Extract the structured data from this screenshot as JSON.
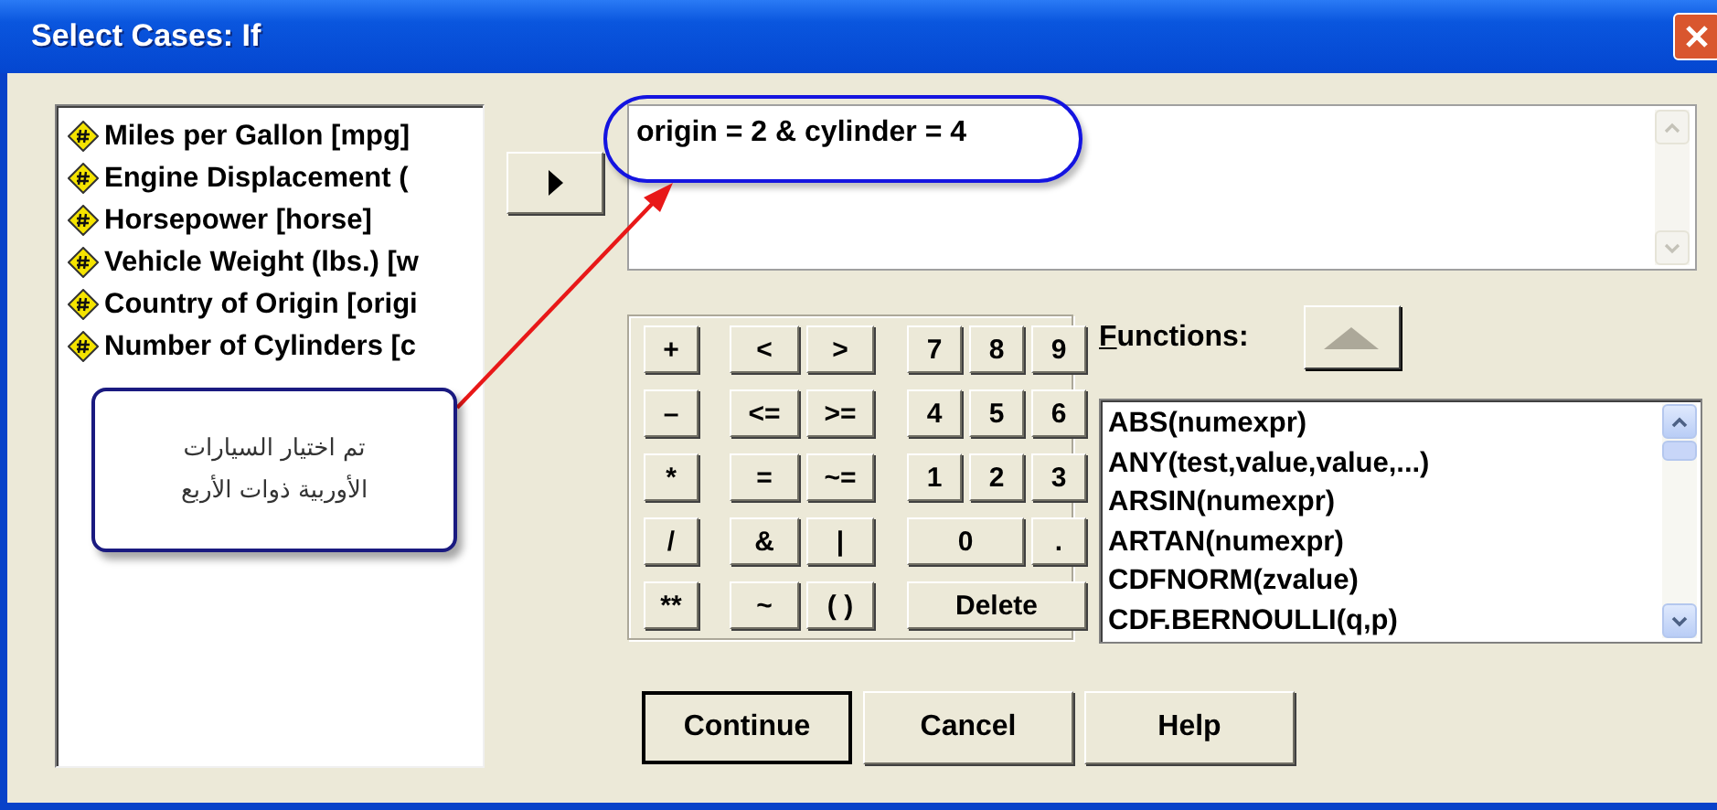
{
  "window": {
    "title": "Select Cases: If"
  },
  "variables": [
    {
      "label": "Miles per Gallon [mpg]"
    },
    {
      "label": "Engine Displacement ("
    },
    {
      "label": "Horsepower [horse]"
    },
    {
      "label": "Vehicle Weight (lbs.) [w"
    },
    {
      "label": "Country of Origin [origi"
    },
    {
      "label": "Number of Cylinders [c"
    }
  ],
  "expression": {
    "value": "origin = 2 & cylinder = 4"
  },
  "keypad": [
    [
      {
        "label": "+",
        "kind": "key"
      },
      {
        "label": "<",
        "kind": "key"
      },
      {
        "label": ">",
        "kind": "key"
      },
      {
        "label": "7",
        "kind": "key"
      },
      {
        "label": "8",
        "kind": "key"
      },
      {
        "label": "9",
        "kind": "key"
      }
    ],
    [
      {
        "label": "–",
        "kind": "key"
      },
      {
        "label": "<=",
        "kind": "key"
      },
      {
        "label": ">=",
        "kind": "key"
      },
      {
        "label": "4",
        "kind": "key"
      },
      {
        "label": "5",
        "kind": "key"
      },
      {
        "label": "6",
        "kind": "key"
      }
    ],
    [
      {
        "label": "*",
        "kind": "key"
      },
      {
        "label": "=",
        "kind": "key"
      },
      {
        "label": "~=",
        "kind": "key"
      },
      {
        "label": "1",
        "kind": "key"
      },
      {
        "label": "2",
        "kind": "key"
      },
      {
        "label": "3",
        "kind": "key"
      }
    ],
    [
      {
        "label": "/",
        "kind": "key"
      },
      {
        "label": "&",
        "kind": "key"
      },
      {
        "label": "|",
        "kind": "key"
      },
      {
        "label": "0",
        "kind": "wide"
      },
      {
        "label": ".",
        "kind": "key"
      }
    ],
    [
      {
        "label": "**",
        "kind": "key"
      },
      {
        "label": "~",
        "kind": "key"
      },
      {
        "label": "( )",
        "kind": "key"
      },
      {
        "label": "Delete",
        "kind": "wider"
      }
    ]
  ],
  "functions": {
    "label": "Functions:",
    "items": [
      "ABS(numexpr)",
      "ANY(test,value,value,...)",
      "ARSIN(numexpr)",
      "ARTAN(numexpr)",
      "CDFNORM(zvalue)",
      "CDF.BERNOULLI(q,p)"
    ]
  },
  "buttons": [
    {
      "label": "Continue",
      "default": true
    },
    {
      "label": "Cancel",
      "default": false
    },
    {
      "label": "Help",
      "default": false
    }
  ],
  "callout": {
    "lines": [
      "تم اختيار السيارات",
      "الأوربية ذوات الأربع"
    ]
  }
}
